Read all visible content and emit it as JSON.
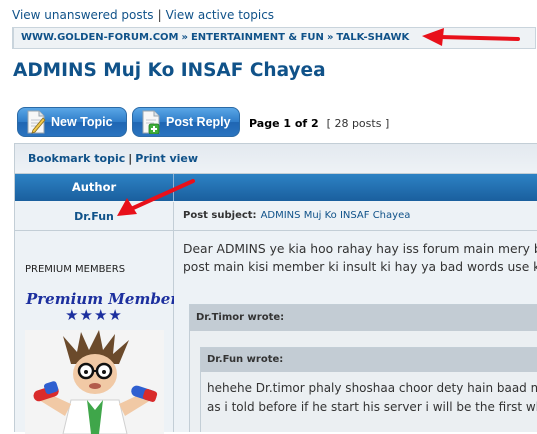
{
  "top_links": {
    "unanswered": "View unanswered posts",
    "separator": "|",
    "active": "View active topics"
  },
  "breadcrumb": {
    "items": [
      "WWW.GOLDEN-FORUM.COM",
      "ENTERTAINMENT & FUN",
      "TALK-SHAWK"
    ],
    "separator": "»"
  },
  "topic_title": "ADMINS Muj Ko INSAF Chayea",
  "buttons": {
    "new_topic": "New Topic",
    "post_reply": "Post Reply"
  },
  "pagination": {
    "page_text": "Page 1 of 2",
    "posts_count": "[ 28 posts ]"
  },
  "post_tools": {
    "bookmark": "Bookmark topic",
    "separator": "|",
    "print": "Print view"
  },
  "table_header": {
    "author": "Author"
  },
  "post": {
    "author": "Dr.Fun",
    "rank_text": "PREMIUM MEMBERS",
    "rank_image_text": "Premium Members",
    "rank_stars": "★★★★",
    "subject_label": "Post subject:",
    "subject": "ADMINS Muj Ko INSAF Chayea",
    "body_lines": [
      "Dear ADMINS ye kia hoo rahay hay iss forum main mery bary",
      "post main kisi member ki insult ki hay ya bad words use kia"
    ],
    "quote_outer_cite": "Dr.Timor wrote:",
    "quote_inner_cite": "Dr.Fun wrote:",
    "quote_inner_lines": [
      "hehehe Dr.timor phaly shoshaa choor dety hain baad main",
      "as i told before if he start his server i will be the first wh"
    ]
  },
  "colors": {
    "link": "#105289",
    "header_blue": "#1a5f9e",
    "annotation_arrow": "#e8101a",
    "button_blue": "#2f7cc9"
  },
  "icons": {
    "new_topic": "new-topic-icon",
    "post_reply": "post-reply-icon"
  }
}
